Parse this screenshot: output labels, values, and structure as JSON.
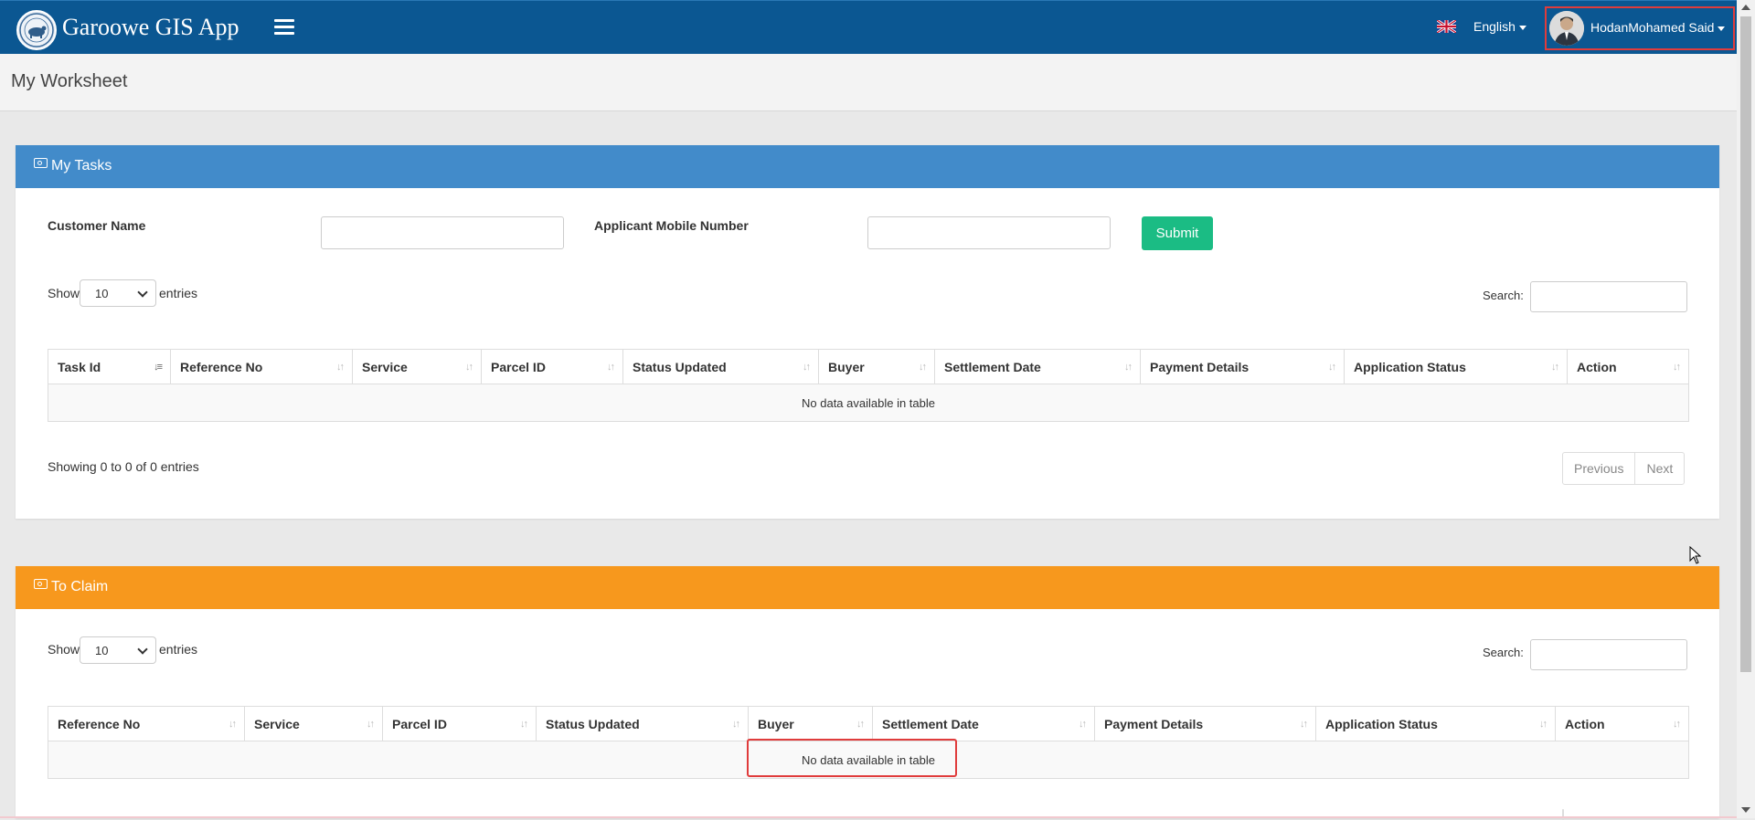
{
  "header": {
    "brand": "Garoowe GIS App",
    "language": "English",
    "user": "HodanMohamed Said"
  },
  "page": {
    "title": "My Worksheet"
  },
  "my_tasks": {
    "title": "My Tasks",
    "customer_name_label": "Customer Name",
    "mobile_label": "Applicant Mobile Number",
    "submit": "Submit",
    "show": "Show",
    "entries": "entries",
    "page_size": "10",
    "search_label": "Search:",
    "columns": [
      "Task Id",
      "Reference No",
      "Service",
      "Parcel ID",
      "Status Updated",
      "Buyer",
      "Settlement Date",
      "Payment Details",
      "Application Status",
      "Action"
    ],
    "empty": "No data available in table",
    "info": "Showing 0 to 0 of 0 entries",
    "prev": "Previous",
    "next": "Next"
  },
  "to_claim": {
    "title": "To Claim",
    "show": "Show",
    "entries": "entries",
    "page_size": "10",
    "search_label": "Search:",
    "columns": [
      "Reference No",
      "Service",
      "Parcel ID",
      "Status Updated",
      "Buyer",
      "Settlement Date",
      "Payment Details",
      "Application Status",
      "Action"
    ],
    "empty": "No data available in table"
  },
  "colors": {
    "navbar": "#0b5792",
    "tasks_header": "#428bca",
    "claim_header": "#f7981d",
    "submit": "#1bbc84"
  }
}
